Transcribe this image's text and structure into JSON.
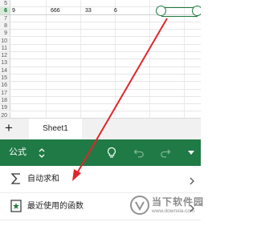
{
  "sheet": {
    "rows": [
      {
        "num": "5",
        "cells": []
      },
      {
        "num": "6",
        "cells": [
          "9",
          "666",
          "33",
          "6"
        ],
        "active": true
      },
      {
        "num": "7",
        "cells": []
      },
      {
        "num": "8",
        "cells": []
      },
      {
        "num": "9",
        "cells": []
      },
      {
        "num": "10",
        "cells": []
      },
      {
        "num": "11",
        "cells": []
      },
      {
        "num": "12",
        "cells": []
      },
      {
        "num": "13",
        "cells": []
      },
      {
        "num": "14",
        "cells": []
      },
      {
        "num": "15",
        "cells": []
      },
      {
        "num": "16",
        "cells": []
      },
      {
        "num": "17",
        "cells": []
      },
      {
        "num": "18",
        "cells": []
      },
      {
        "num": "19",
        "cells": []
      },
      {
        "num": "20",
        "cells": []
      }
    ]
  },
  "tabbar": {
    "add_label": "+",
    "sheet_name": "Sheet1"
  },
  "ribbon": {
    "title": "公式",
    "accent": "#1f7a45"
  },
  "menu": {
    "items": [
      {
        "label": "自动求和",
        "icon": "sigma-icon"
      },
      {
        "label": "最近使用的函数",
        "icon": "star-icon"
      }
    ]
  },
  "watermark": {
    "text": "当下软件园",
    "url": "www.downxia.com"
  },
  "annotation": {
    "color": "#e0262b"
  }
}
